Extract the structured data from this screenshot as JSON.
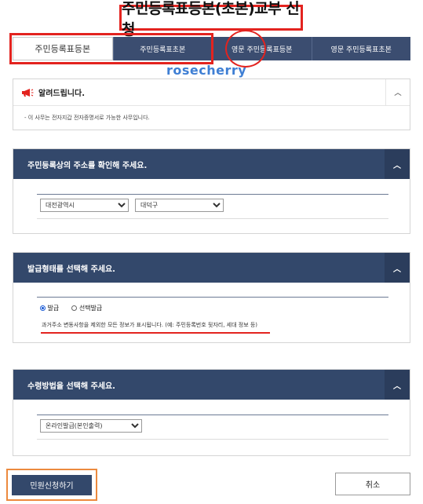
{
  "page_title": "주민등록표등본(초본)교부 신청",
  "tabs": [
    {
      "label": "주민등록표등본",
      "active": true
    },
    {
      "label": "주민등록표초본",
      "active": false
    },
    {
      "label": "영문 주민등록표등본",
      "active": false
    },
    {
      "label": "영문 주민등록표초본",
      "active": false
    }
  ],
  "watermark": "rosecherry",
  "notice": {
    "title": "알려드립니다.",
    "body": "- 이 사무는 전자지갑 전자증명서로 가능한 사무입니다."
  },
  "address_section": {
    "title": "주민등록상의 주소를 확인해 주세요.",
    "city_value": "대전광역시",
    "district_value": "대덕구"
  },
  "issue_section": {
    "title": "발급형태를 선택해 주세요.",
    "option_full": "발급",
    "option_select": "선택발급",
    "selected": "발급",
    "description": "과거주소 변동사항을 제외한 모든 정보가 표시됩니다. (예: 주민등록번호 뒷자리, 세대 정보 등)"
  },
  "receive_section": {
    "title": "수령방법을 선택해 주세요.",
    "method_value": "온라인발급(본인출력)"
  },
  "buttons": {
    "submit": "민원신청하기",
    "cancel": "취소"
  },
  "colors": {
    "header_navy": "#33486b",
    "annotation_red": "#e3231f",
    "annotation_orange": "#ec8a3e",
    "watermark_blue": "#3f7fd4"
  }
}
